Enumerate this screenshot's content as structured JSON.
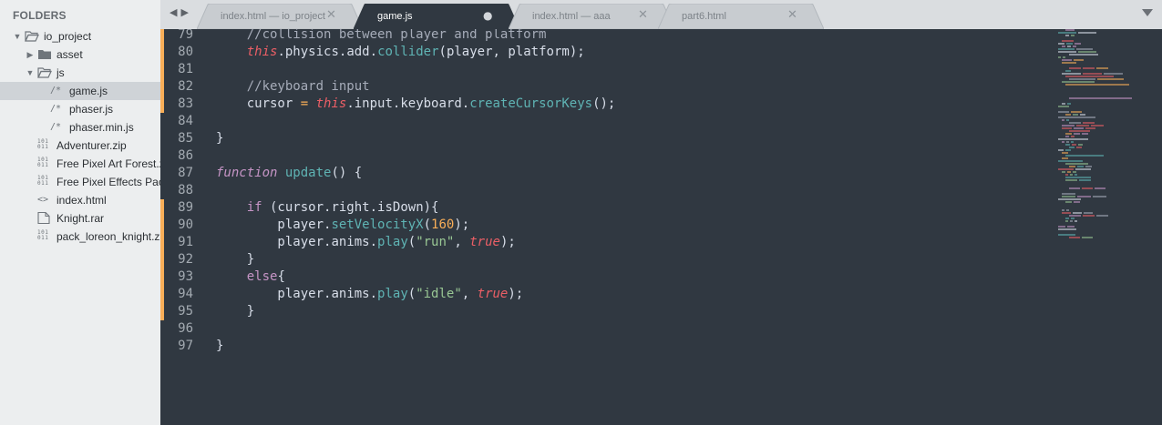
{
  "sidebar": {
    "header": "FOLDERS",
    "items": [
      {
        "label": "io_project",
        "type": "folder-open",
        "icon": "folder-open-icon",
        "arrow": "expanded",
        "depth": 0
      },
      {
        "label": "asset",
        "type": "folder",
        "icon": "folder-icon",
        "arrow": "collapsed",
        "depth": 1
      },
      {
        "label": "js",
        "type": "folder-open",
        "icon": "folder-open-icon",
        "arrow": "expanded",
        "depth": 1
      },
      {
        "label": "game.js",
        "type": "file-js",
        "icon": "js-file-icon",
        "glyph": "/*",
        "depth": 2,
        "selected": true
      },
      {
        "label": "phaser.js",
        "type": "file-js",
        "icon": "js-file-icon",
        "glyph": "/*",
        "depth": 2
      },
      {
        "label": "phaser.min.js",
        "type": "file-js",
        "icon": "js-file-icon",
        "glyph": "/*",
        "depth": 2
      },
      {
        "label": "Adventurer.zip",
        "type": "file-binary",
        "icon": "binary-file-icon",
        "glyph": "101\n011",
        "depth": 1
      },
      {
        "label": "Free Pixel Art Forest.zip",
        "type": "file-binary",
        "icon": "binary-file-icon",
        "glyph": "101\n011",
        "depth": 1
      },
      {
        "label": "Free Pixel Effects Pack",
        "type": "file-binary",
        "icon": "binary-file-icon",
        "glyph": "101\n011",
        "depth": 1
      },
      {
        "label": "index.html",
        "type": "file-html",
        "icon": "html-file-icon",
        "glyph": "<>",
        "depth": 1
      },
      {
        "label": "Knight.rar",
        "type": "file-generic",
        "icon": "document-icon",
        "depth": 1
      },
      {
        "label": "pack_loreon_knight.zip",
        "type": "file-binary",
        "icon": "binary-file-icon",
        "glyph": "101\n011",
        "depth": 1
      }
    ]
  },
  "tabbar": {
    "nav_back": "◀",
    "nav_forward": "▶",
    "tabs": [
      {
        "label": "index.html — io_project",
        "close": "✕",
        "active": false
      },
      {
        "label": "game.js",
        "close": "●",
        "active": true,
        "modified": true
      },
      {
        "label": "index.html — aaa",
        "close": "✕",
        "active": false
      },
      {
        "label": "part6.html",
        "close": "✕",
        "active": false
      }
    ]
  },
  "editor": {
    "colors": {
      "background": "#303841",
      "modified_marker": "#f9ae58"
    },
    "lines": [
      {
        "num": "79",
        "modified": true,
        "tokens": [
          [
            "plain",
            "    "
          ],
          [
            "comment",
            "//collision between player and platform"
          ]
        ]
      },
      {
        "num": "80",
        "modified": true,
        "tokens": [
          [
            "plain",
            "    "
          ],
          [
            "this",
            "this"
          ],
          [
            "punct",
            "."
          ],
          [
            "plain",
            "physics"
          ],
          [
            "punct",
            "."
          ],
          [
            "plain",
            "add"
          ],
          [
            "punct",
            "."
          ],
          [
            "method",
            "collider"
          ],
          [
            "punct",
            "("
          ],
          [
            "plain",
            "player"
          ],
          [
            "punct",
            ", "
          ],
          [
            "plain",
            "platform"
          ],
          [
            "punct",
            ");"
          ]
        ]
      },
      {
        "num": "81",
        "modified": true,
        "tokens": []
      },
      {
        "num": "82",
        "modified": true,
        "tokens": [
          [
            "plain",
            "    "
          ],
          [
            "comment",
            "//keyboard input"
          ]
        ]
      },
      {
        "num": "83",
        "modified": true,
        "tokens": [
          [
            "plain",
            "    cursor "
          ],
          [
            "op",
            "="
          ],
          [
            "plain",
            " "
          ],
          [
            "this",
            "this"
          ],
          [
            "punct",
            "."
          ],
          [
            "plain",
            "input"
          ],
          [
            "punct",
            "."
          ],
          [
            "plain",
            "keyboard"
          ],
          [
            "punct",
            "."
          ],
          [
            "method",
            "createCursorKeys"
          ],
          [
            "punct",
            "();"
          ]
        ]
      },
      {
        "num": "84",
        "modified": false,
        "tokens": []
      },
      {
        "num": "85",
        "modified": false,
        "tokens": [
          [
            "punct",
            "}"
          ]
        ]
      },
      {
        "num": "86",
        "modified": false,
        "tokens": []
      },
      {
        "num": "87",
        "modified": false,
        "tokens": [
          [
            "keyword",
            "function"
          ],
          [
            "plain",
            " "
          ],
          [
            "func",
            "update"
          ],
          [
            "punct",
            "() {"
          ]
        ]
      },
      {
        "num": "88",
        "modified": false,
        "tokens": []
      },
      {
        "num": "89",
        "modified": true,
        "tokens": [
          [
            "plain",
            "    "
          ],
          [
            "keywordplain",
            "if"
          ],
          [
            "plain",
            " (cursor"
          ],
          [
            "punct",
            "."
          ],
          [
            "plain",
            "right"
          ],
          [
            "punct",
            "."
          ],
          [
            "plain",
            "isDown){"
          ]
        ]
      },
      {
        "num": "90",
        "modified": true,
        "tokens": [
          [
            "plain",
            "        player"
          ],
          [
            "punct",
            "."
          ],
          [
            "method",
            "setVelocityX"
          ],
          [
            "punct",
            "("
          ],
          [
            "number",
            "160"
          ],
          [
            "punct",
            ");"
          ]
        ]
      },
      {
        "num": "91",
        "modified": true,
        "tokens": [
          [
            "plain",
            "        player"
          ],
          [
            "punct",
            "."
          ],
          [
            "plain",
            "anims"
          ],
          [
            "punct",
            "."
          ],
          [
            "method",
            "play"
          ],
          [
            "punct",
            "("
          ],
          [
            "string",
            "\"run\""
          ],
          [
            "punct",
            ", "
          ],
          [
            "bool",
            "true"
          ],
          [
            "punct",
            ");"
          ]
        ]
      },
      {
        "num": "92",
        "modified": true,
        "tokens": [
          [
            "plain",
            "    "
          ],
          [
            "punct",
            "}"
          ]
        ]
      },
      {
        "num": "93",
        "modified": true,
        "tokens": [
          [
            "plain",
            "    "
          ],
          [
            "keywordplain",
            "else"
          ],
          [
            "punct",
            "{"
          ]
        ]
      },
      {
        "num": "94",
        "modified": true,
        "tokens": [
          [
            "plain",
            "        player"
          ],
          [
            "punct",
            "."
          ],
          [
            "plain",
            "anims"
          ],
          [
            "punct",
            "."
          ],
          [
            "method",
            "play"
          ],
          [
            "punct",
            "("
          ],
          [
            "string",
            "\"idle\""
          ],
          [
            "punct",
            ", "
          ],
          [
            "bool",
            "true"
          ],
          [
            "punct",
            ");"
          ]
        ]
      },
      {
        "num": "95",
        "modified": true,
        "tokens": [
          [
            "plain",
            "    "
          ],
          [
            "punct",
            "}"
          ]
        ]
      },
      {
        "num": "96",
        "modified": false,
        "tokens": []
      },
      {
        "num": "97",
        "modified": false,
        "tokens": [
          [
            "punct",
            "}"
          ]
        ]
      }
    ]
  }
}
